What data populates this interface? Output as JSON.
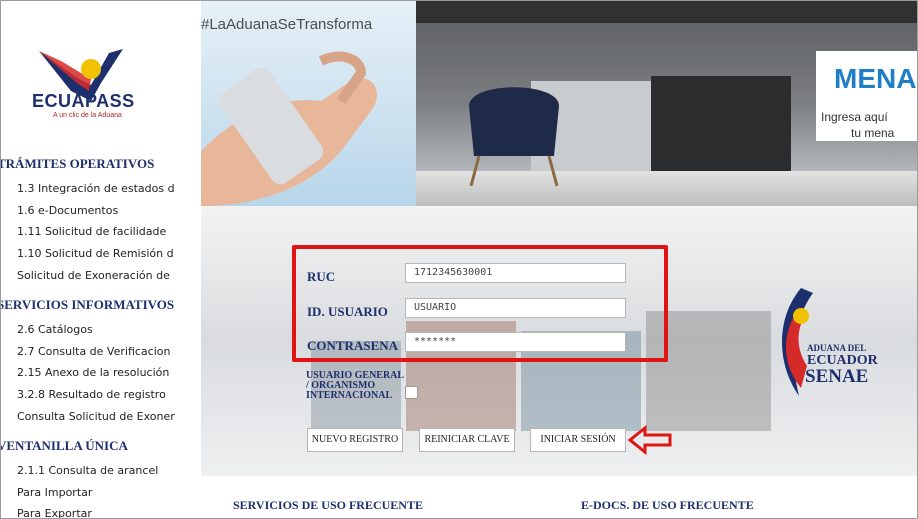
{
  "brand": {
    "name": "ECUAPASS",
    "tagline": "A un clic de la Aduana"
  },
  "sidebar": {
    "sections": [
      {
        "title": "TRÁMITES OPERATIVOS",
        "items": [
          "1.3 Integración de estados d",
          "1.6 e-Documentos",
          "1.11 Solicitud de facilidade",
          "1.10 Solicitud de Remisión d",
          "Solicitud de Exoneración de"
        ]
      },
      {
        "title": "SERVICIOS INFORMATIVOS",
        "items": [
          "2.6 Catálogos",
          "2.7 Consulta de Verificacion",
          "2.15 Anexo de la resolución",
          "3.2.8 Resultado de registro",
          "Consulta Solicitud de Exoner"
        ]
      },
      {
        "title": "VENTANILLA ÚNICA",
        "items": [
          "2.1.1 Consulta de arancel",
          "Para Importar",
          "Para Exportar"
        ]
      }
    ]
  },
  "banner": {
    "hashtag": "#LaAduanaSeTransforma",
    "title": "MENA",
    "subtitle_line1": "Ingresa aquí",
    "subtitle_line2": "tu mena"
  },
  "login": {
    "ruc_label": "RUC",
    "ruc_value": "1712345630001",
    "user_label": "ID. USUARIO",
    "user_value": "USUARIO",
    "password_label": "CONTRASENA",
    "password_value": "*******",
    "general_user_label": "USUARIO GENERAL / ORGANISMO INTERNACIONAL",
    "buttons": {
      "new_registration": "NUEVO REGISTRO",
      "reset_password": "REINICIAR CLAVE",
      "sign_in": "INICIAR SESIÓN"
    }
  },
  "senae": {
    "line1": "ADUANA DEL",
    "line2": "ECUADOR",
    "line3": "SENAE"
  },
  "footer": {
    "frequent_services": "SERVICIOS DE USO FRECUENTE",
    "frequent_edocs": "E-DOCS. DE USO FRECUENTE"
  },
  "colors": {
    "navy": "#1e2f6e",
    "highlight_red": "#e11414",
    "banner_blue": "#1f7ec6"
  }
}
